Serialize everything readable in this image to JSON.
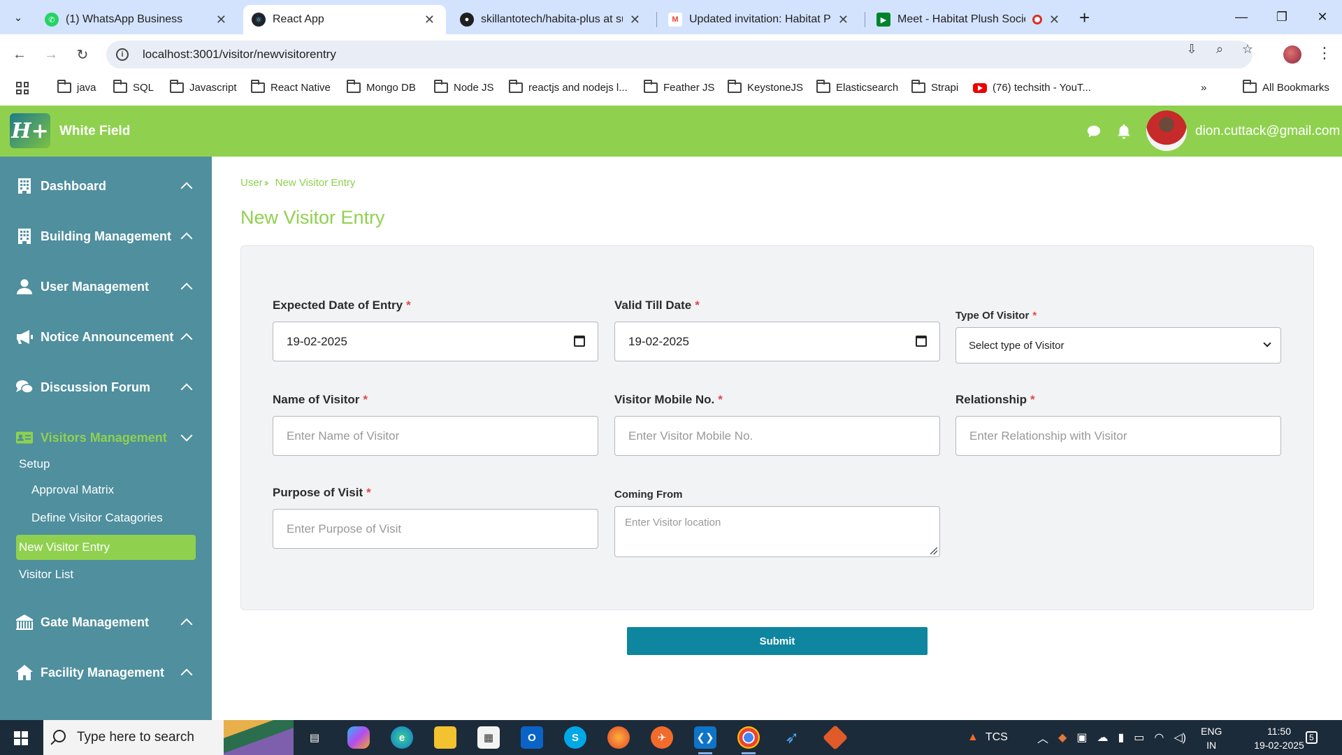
{
  "browser": {
    "tabs": [
      {
        "title": "(1) WhatsApp Business",
        "icon": "whatsapp-icon"
      },
      {
        "title": "React App",
        "icon": "react-icon"
      },
      {
        "title": "skillantotech/habita-plus at sub",
        "icon": "github-icon"
      },
      {
        "title": "Updated invitation: Habitat Plus",
        "icon": "gmail-icon"
      },
      {
        "title": "Meet - Habitat Plush Societ",
        "icon": "meet-icon"
      }
    ],
    "url": "localhost:3001/visitor/newvisitorentry",
    "bookmarks": [
      "java",
      "SQL",
      "Javascript",
      "React Native",
      "Mongo DB",
      "Node JS",
      "reactjs and nodejs l...",
      "Feather JS",
      "KeystoneJS",
      "Elasticsearch",
      "Strapi",
      "(76) techsith - YouT...",
      "All Bookmarks"
    ]
  },
  "header": {
    "logo_text": "H+",
    "society_name": "White Field",
    "user_email": "dion.cuttack@gmail.com"
  },
  "sidebar": {
    "menus": [
      {
        "label": "Dashboard",
        "icon": "building-icon"
      },
      {
        "label": "Building Management",
        "icon": "building-icon"
      },
      {
        "label": "User Management",
        "icon": "user-icon"
      },
      {
        "label": "Notice Announcement",
        "icon": "megaphone-icon"
      },
      {
        "label": "Discussion Forum",
        "icon": "comments-icon"
      },
      {
        "label": "Visitors Management",
        "icon": "id-card-icon"
      },
      {
        "label": "Gate Management",
        "icon": "gate-icon"
      },
      {
        "label": "Facility Management",
        "icon": "home-icon"
      }
    ],
    "submenu": {
      "setup": "Setup",
      "approval_matrix": "Approval Matrix",
      "define_categories": "Define Visitor Catagories",
      "new_entry": "New Visitor Entry",
      "visitor_list": "Visitor List"
    }
  },
  "breadcrumb": {
    "root": "User",
    "current": "New Visitor Entry"
  },
  "page_title": "New Visitor Entry",
  "form": {
    "expected_date_label": "Expected Date of Entry",
    "expected_date_value": "19-02-2025",
    "valid_till_label": "Valid Till Date",
    "valid_till_value": "19-02-2025",
    "visitor_type_label": "Type Of Visitor",
    "visitor_type_value": "Select type of Visitor",
    "name_label": "Name of Visitor",
    "name_placeholder": "Enter Name of Visitor",
    "mobile_label": "Visitor Mobile No.",
    "mobile_placeholder": "Enter Visitor Mobile No.",
    "relationship_label": "Relationship",
    "relationship_placeholder": "Enter Relationship with Visitor",
    "purpose_label": "Purpose of Visit",
    "purpose_placeholder": "Enter Purpose of Visit",
    "coming_from_label": "Coming From",
    "coming_from_placeholder": "Enter Visitor location",
    "required_mark": "*",
    "submit_label": "Submit"
  },
  "taskbar": {
    "search_placeholder": "Type here to search",
    "tray_label": "TCS",
    "lang_line1": "ENG",
    "lang_line2": "IN",
    "time": "11:50",
    "date": "19-02-2025",
    "notifications": "5"
  },
  "colors": {
    "brand_green": "#8fd14f",
    "sidebar_teal": "#4f8f9e",
    "submit_blue": "#0e869f",
    "required_red": "#e04848"
  }
}
